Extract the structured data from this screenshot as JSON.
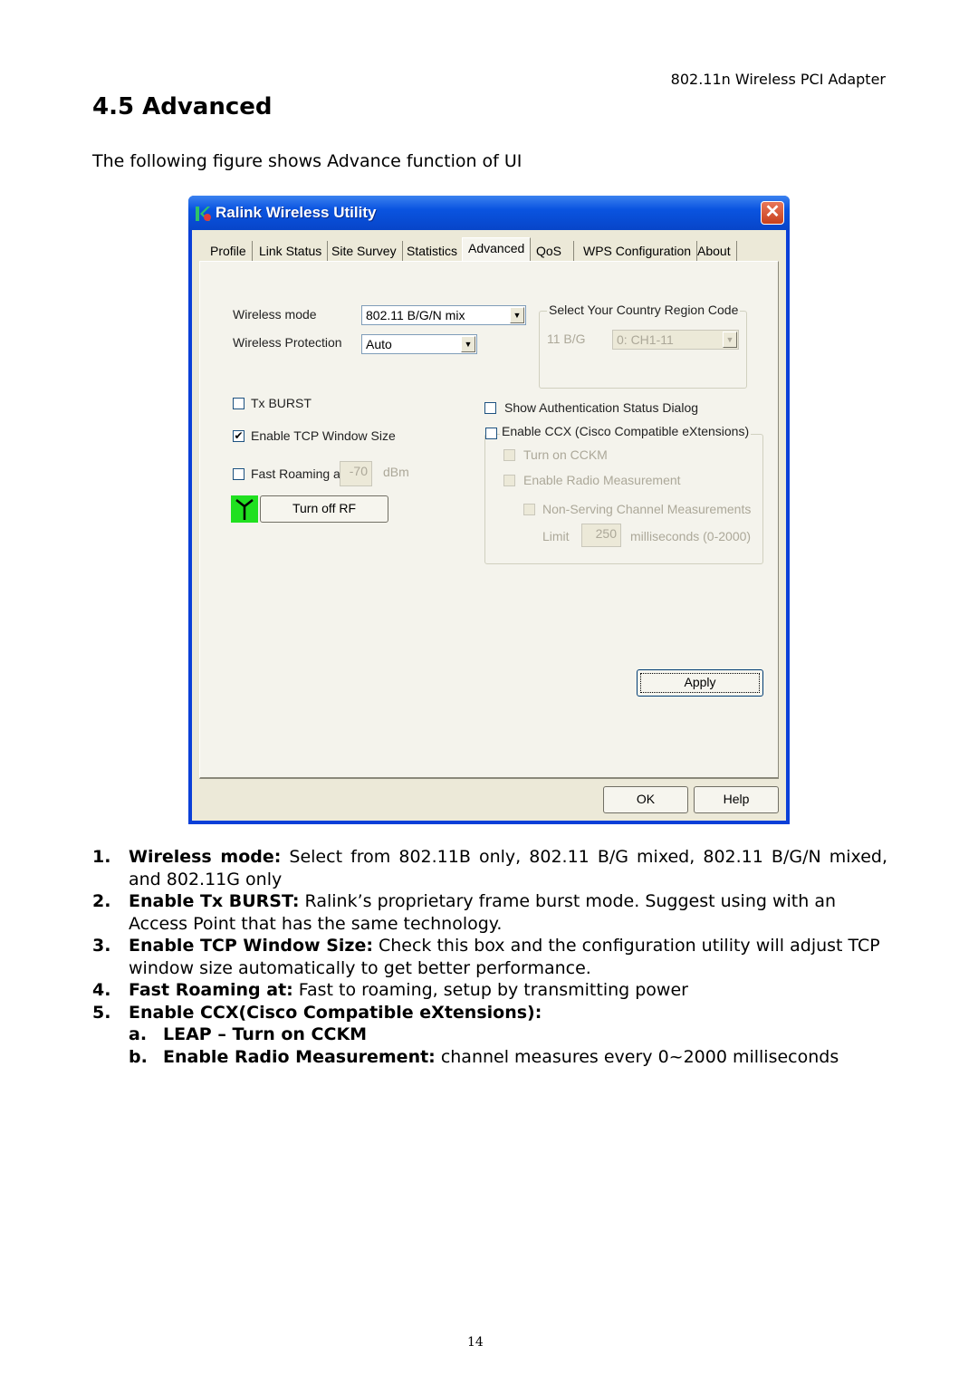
{
  "page": {
    "header": "802.11n Wireless PCI Adapter",
    "section_title": "4.5 Advanced",
    "intro": "The following figure shows Advance function of UI",
    "page_number": "14"
  },
  "window": {
    "title": "Ralink Wireless Utility",
    "close_label": "✕",
    "tabs": [
      {
        "label": "Profile",
        "active": false
      },
      {
        "label": "Link Status",
        "active": false
      },
      {
        "label": "Site Survey",
        "active": false
      },
      {
        "label": "Statistics",
        "active": false
      },
      {
        "label": "Advanced",
        "active": true
      },
      {
        "label": "QoS",
        "active": false
      },
      {
        "label": "WPS Configuration",
        "active": false
      },
      {
        "label": "About",
        "active": false
      }
    ],
    "advanced": {
      "wireless_mode_label": "Wireless mode",
      "wireless_mode_value": "802.11 B/G/N mix",
      "wireless_protection_label": "Wireless Protection",
      "wireless_protection_value": "Auto",
      "country_group_title": "Select Your Country Region Code",
      "country_band_label": "11 B/G",
      "country_value": "0: CH1-11",
      "tx_burst_label": "Tx BURST",
      "tx_burst_checked": false,
      "tcp_window_label": "Enable TCP Window Size",
      "tcp_window_checked": true,
      "fast_roaming_label": "Fast Roaming at",
      "fast_roaming_checked": false,
      "fast_roaming_value": "-70",
      "fast_roaming_unit": "dBm",
      "turn_off_rf_label": "Turn off RF",
      "show_auth_label": "Show Authentication Status Dialog",
      "show_auth_checked": false,
      "ccx_label": "Enable CCX (Cisco Compatible eXtensions)",
      "ccx_checked": false,
      "cckm_label": "Turn on CCKM",
      "radio_measurement_label": "Enable Radio Measurement",
      "non_serving_label": "Non-Serving Channel Measurements",
      "limit_label": "Limit",
      "limit_value": "250",
      "limit_unit": "milliseconds (0-2000)",
      "apply_label": "Apply"
    },
    "ok_label": "OK",
    "help_label": "Help",
    "check_glyph": "✔",
    "arrow_glyph": "▼"
  },
  "list": [
    {
      "num": "1.",
      "bold": "Wireless mode:",
      "text": " Select from 802.11B only, 802.11 B/G mixed, 802.11 B/G/N mixed, and 802.11G only"
    },
    {
      "num": "2.",
      "bold": "Enable Tx BURST:",
      "text": " Ralink’s proprietary frame burst mode. Suggest using with an Access Point that has the same technology."
    },
    {
      "num": "3.",
      "bold": "Enable TCP Window Size:",
      "text": " Check this box and the configuration utility will adjust TCP window size automatically to get better performance."
    },
    {
      "num": "4.",
      "bold": "Fast Roaming at:",
      "text": " Fast to roaming, setup by transmitting power"
    },
    {
      "num": "5.",
      "bold": "Enable CCX(Cisco Compatible eXtensions):",
      "text": ""
    }
  ],
  "sublist": [
    {
      "num": "a.",
      "bold": "LEAP – Turn on CCKM",
      "text": ""
    },
    {
      "num": "b.",
      "bold": "Enable Radio Measurement:",
      "text": " channel measures every 0~2000 milliseconds"
    }
  ]
}
